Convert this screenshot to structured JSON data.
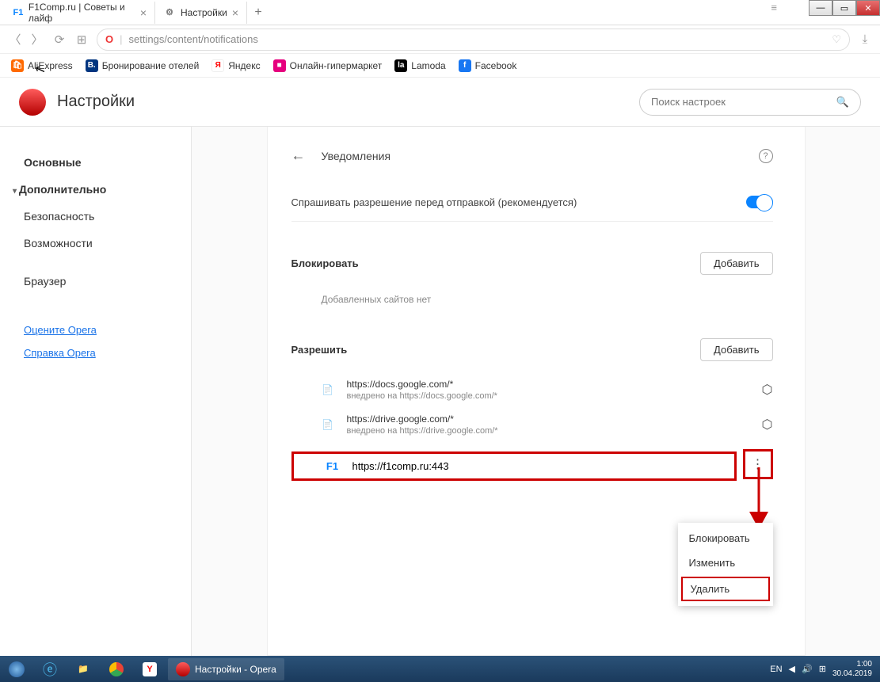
{
  "window": {
    "tabs": [
      {
        "favicon": "F1",
        "favColor": "#0a84ff",
        "title": "F1Comp.ru | Советы и лайф",
        "active": false
      },
      {
        "favicon": "⚙",
        "favColor": "#777",
        "title": "Настройки",
        "active": true
      }
    ]
  },
  "addressBar": {
    "url": "settings/content/notifications"
  },
  "bookmarks": [
    {
      "label": "AliExpress",
      "color": "#ff6a00"
    },
    {
      "label": "Бронирование отелей",
      "color": "#003580",
      "icon": "B."
    },
    {
      "label": "Яндекс",
      "color": "#ff0000",
      "icon": "Я"
    },
    {
      "label": "Онлайн-гипермаркет",
      "color": "#e6007e",
      "icon": "■"
    },
    {
      "label": "Lamoda",
      "color": "#000",
      "icon": "la"
    },
    {
      "label": "Facebook",
      "color": "#1877f2",
      "icon": "f"
    }
  ],
  "settings": {
    "title": "Настройки",
    "searchPlaceholder": "Поиск настроек",
    "sidebar": {
      "basic": "Основные",
      "advanced": "Дополнительно",
      "security": "Безопасность",
      "features": "Возможности",
      "browser": "Браузер",
      "rate": "Оцените Opera",
      "help": "Справка Opera"
    },
    "page": {
      "title": "Уведомления",
      "askLabel": "Спрашивать разрешение перед отправкой (рекомендуется)",
      "blockHead": "Блокировать",
      "blockEmpty": "Добавленных сайтов нет",
      "allowHead": "Разрешить",
      "addBtn": "Добавить",
      "sites": [
        {
          "url": "https://docs.google.com/*",
          "sub": "внедрено на https://docs.google.com/*"
        },
        {
          "url": "https://drive.google.com/*",
          "sub": "внедрено на https://drive.google.com/*"
        }
      ],
      "highlightSite": "https://f1comp.ru:443"
    },
    "contextMenu": {
      "block": "Блокировать",
      "edit": "Изменить",
      "remove": "Удалить"
    }
  },
  "taskbar": {
    "appTitle": "Настройки - Opera",
    "lang": "EN",
    "time": "1:00",
    "date": "30.04.2019"
  }
}
